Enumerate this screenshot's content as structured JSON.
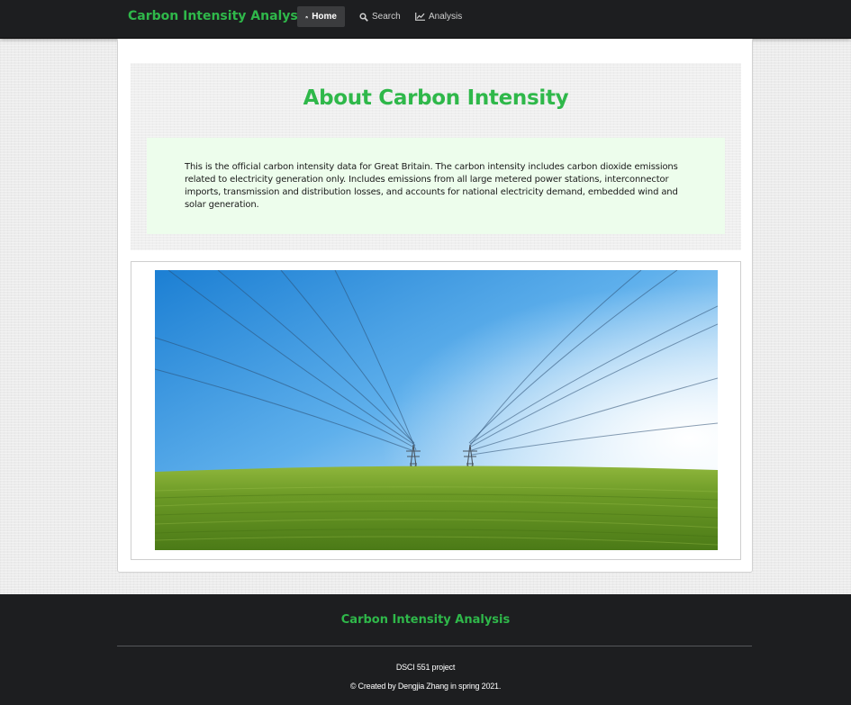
{
  "navbar": {
    "brand": "Carbon Intensity Analysis",
    "items": [
      {
        "label": "Home",
        "icon": "home-icon",
        "active": true
      },
      {
        "label": "Search",
        "icon": "search-icon",
        "active": false
      },
      {
        "label": "Analysis",
        "icon": "line-chart-icon",
        "active": false
      }
    ]
  },
  "main": {
    "title": "About Carbon Intensity",
    "description": "This is the official carbon intensity data for Great Britain. The carbon intensity includes carbon dioxide emissions related to electricity generation only. Includes emissions from all large metered power stations, interconnector imports, transmission and distribution losses, and accounts for national electricity demand, embedded wind and solar generation.",
    "image": "photo of electricity pylons over a green grass field under a blue sky"
  },
  "footer": {
    "brand": "Carbon Intensity Analysis",
    "line1": "DSCI 551 project",
    "line2": "© Created by Dengjia Zhang in spring 2021."
  },
  "colors": {
    "accent": "#2fb84a",
    "navbar_bg": "#1d1e20",
    "about_box_bg": "#edfdec"
  }
}
